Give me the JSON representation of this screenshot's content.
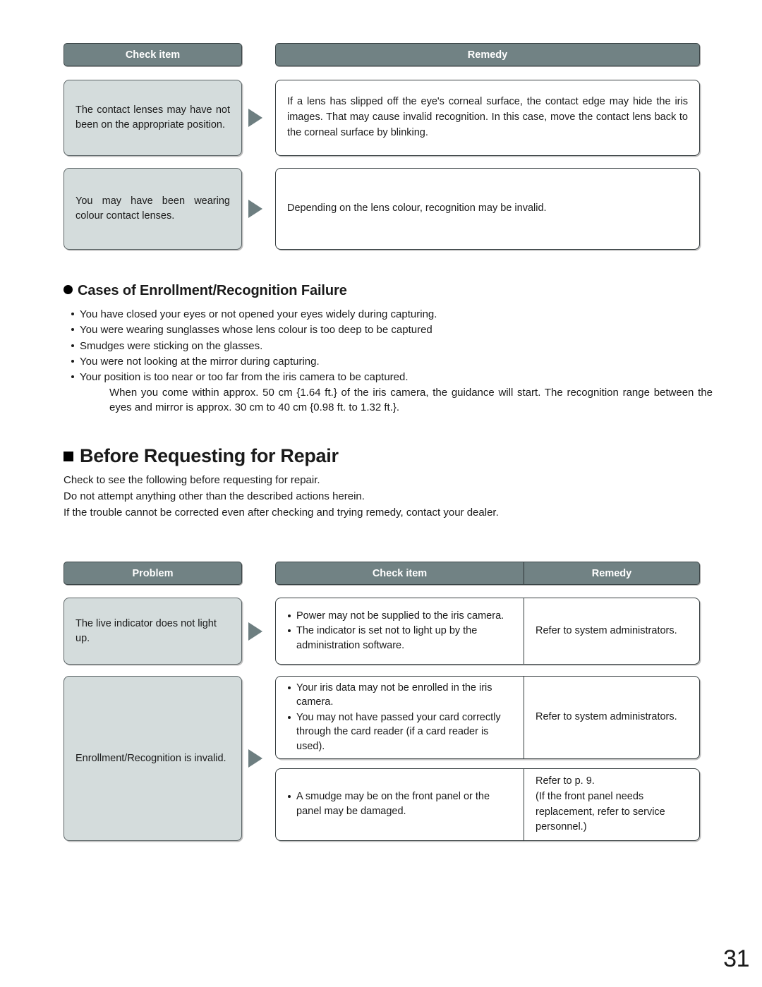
{
  "page": {
    "number": "31"
  },
  "table_top": {
    "headers": {
      "check_item": "Check item",
      "remedy": "Remedy"
    },
    "rows": [
      {
        "check_item": "The contact lenses may have not been on the appropriate position.",
        "remedy": "If a lens has slipped off the eye's corneal surface, the contact edge may hide the iris images. That may cause invalid recognition. In this case, move the contact lens back to the corneal surface by blinking."
      },
      {
        "check_item": "You may have been wearing colour contact lenses.",
        "remedy": "Depending on the lens colour, recognition may be invalid."
      }
    ]
  },
  "section_failure": {
    "heading": "Cases of Enrollment/Recognition Failure",
    "bullets": [
      "You have closed your eyes or not opened your eyes widely during capturing.",
      "You were wearing sunglasses whose lens colour is too deep to be captured",
      "Smudges were sticking on the glasses.",
      "You were not looking at the mirror during capturing.",
      "Your position is too near or too far from the iris camera to be captured."
    ],
    "sub_paragraph": "When you come within approx. 50 cm {1.64 ft.} of the iris camera, the guidance will start. The recognition range between the eyes and mirror is approx. 30 cm to 40 cm {0.98 ft. to 1.32 ft.}."
  },
  "section_repair": {
    "heading": "Before Requesting for Repair",
    "lines": [
      "Check to see the following before requesting for repair.",
      "Do not attempt anything other than the described actions herein.",
      "If the trouble cannot be corrected even after checking and trying remedy, contact your dealer."
    ]
  },
  "table_bottom": {
    "headers": {
      "problem": "Problem",
      "check_item": "Check item",
      "remedy": "Remedy"
    },
    "rows": [
      {
        "problem": "The live indicator does not light up.",
        "check_items": [
          "Power may not be supplied to the iris camera.",
          "The indicator is set not to light up by the administration software."
        ],
        "remedy": "Refer to system administrators."
      },
      {
        "problem": "Enrollment/Recognition is invalid.",
        "groups": [
          {
            "check_items": [
              "Your iris data may not be enrolled in the iris camera.",
              "You may not have passed your card correctly through the card reader (if a card reader is used)."
            ],
            "remedy": "Refer to system administrators."
          },
          {
            "check_items": [
              "A smudge may be on the front panel or the panel may be damaged."
            ],
            "remedy": "Refer to p. 9.\n(If the front panel needs replacement, refer to service personnel.)"
          }
        ]
      }
    ]
  },
  "colors": {
    "header_bar": "#718284",
    "cell_gray": "#d4dcdc",
    "arrow": "#6d7e80",
    "text": "#1a1a1a"
  }
}
